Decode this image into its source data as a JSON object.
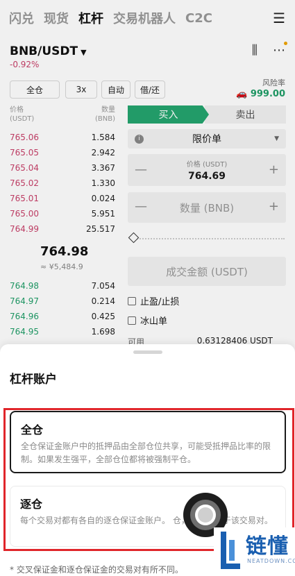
{
  "nav": {
    "tabs": [
      "闪兑",
      "现货",
      "杠杆",
      "交易机器人",
      "C2C"
    ],
    "active_tab": "杠杆"
  },
  "market": {
    "pair": "BNB/USDT",
    "change": "-0.92%"
  },
  "controls": {
    "margin_mode": "全仓",
    "leverage": "3x",
    "auto": "自动",
    "borrow": "借/还"
  },
  "risk": {
    "label": "风险率",
    "value": "999.00"
  },
  "orderbook": {
    "price_header": "价格\n(USDT)",
    "qty_header": "数量\n(BNB)",
    "asks": [
      {
        "price": "765.06",
        "qty": "1.584"
      },
      {
        "price": "765.05",
        "qty": "2.942"
      },
      {
        "price": "765.04",
        "qty": "3.367"
      },
      {
        "price": "765.02",
        "qty": "1.330"
      },
      {
        "price": "765.01",
        "qty": "0.024"
      },
      {
        "price": "765.00",
        "qty": "5.951"
      },
      {
        "price": "764.99",
        "qty": "25.517"
      }
    ],
    "last_price": "764.98",
    "last_price_cny": "≈ ¥5,484.9",
    "bids": [
      {
        "price": "764.98",
        "qty": "7.054"
      },
      {
        "price": "764.97",
        "qty": "0.214"
      },
      {
        "price": "764.96",
        "qty": "0.425"
      },
      {
        "price": "764.95",
        "qty": "1.698"
      }
    ]
  },
  "trade": {
    "buy": "买入",
    "sell": "卖出",
    "order_type": "限价单",
    "price_label": "价格 (USDT)",
    "price_value": "764.69",
    "qty_placeholder": "数量 (BNB)",
    "amount_placeholder": "成交金额 (USDT)",
    "tp_sl": "止盈/止损",
    "iceberg": "冰山单",
    "available_label": "可用",
    "available_value": "0.63128406 USDT"
  },
  "sheet": {
    "title": "杠杆账户",
    "options": [
      {
        "title": "全仓",
        "desc": "全仓保证金账户中的抵押品由全部仓位共享，可能受抵押品比率的限制。如果发生强平，全部仓位都将被强制平仓。"
      },
      {
        "title": "逐仓",
        "desc": "每个交易对都有各自的逐仓保证金账户。                      仓，风险仅限于该交易对。"
      }
    ],
    "footnote": "* 交叉保证金和逐仓保证金的交易对有所不同。"
  },
  "watermark": {
    "name": "链懂",
    "url": "NEATDOWN.COM"
  },
  "colors": {
    "up": "#1f9e68",
    "down": "#c9406a",
    "highlight_frame": "#e0252a"
  }
}
